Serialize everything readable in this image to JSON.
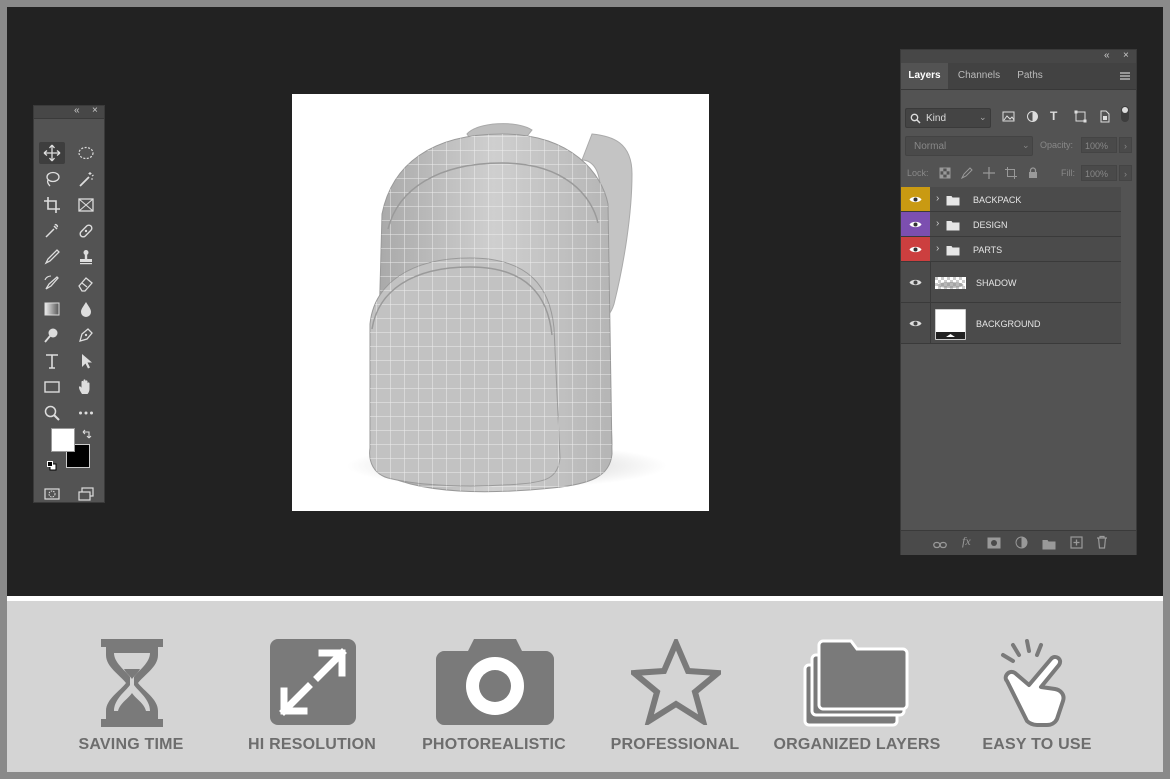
{
  "layers_panel": {
    "tabs": [
      {
        "label": "Layers",
        "active": true
      },
      {
        "label": "Channels",
        "active": false
      },
      {
        "label": "Paths",
        "active": false
      }
    ],
    "filter_label": "Kind",
    "blend_mode": "Normal",
    "opacity_label": "Opacity:",
    "opacity_value": "100%",
    "lock_label": "Lock:",
    "fill_label": "Fill:",
    "fill_value": "100%",
    "layers": [
      {
        "name": "BACKPACK",
        "type": "group",
        "color": "#c99a12"
      },
      {
        "name": "DESIGN",
        "type": "group",
        "color": "#7c4fb0"
      },
      {
        "name": "PARTS",
        "type": "group",
        "color": "#cc3f3f"
      },
      {
        "name": "SHADOW",
        "type": "layer",
        "color": ""
      },
      {
        "name": "BACKGROUND",
        "type": "layer",
        "color": ""
      }
    ]
  },
  "features": [
    {
      "label": "SAVING TIME",
      "icon": "hourglass-icon"
    },
    {
      "label": "HI RESOLUTION",
      "icon": "expand-icon"
    },
    {
      "label": "PHOTOREALISTIC",
      "icon": "camera-icon"
    },
    {
      "label": "PROFESSIONAL",
      "icon": "star-icon"
    },
    {
      "label": "ORGANIZED LAYERS",
      "icon": "folders-icon"
    },
    {
      "label": "EASY TO USE",
      "icon": "hand-click-icon"
    }
  ],
  "colors": {
    "workspace": "#222222",
    "panel": "#535353",
    "feature_bar": "#d4d4d4",
    "feature_text": "#6d6d6d",
    "feature_icon": "#7a7a7a"
  }
}
